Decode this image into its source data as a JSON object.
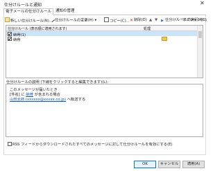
{
  "window": {
    "title": "仕分けルールと通知",
    "close_glyph": "✕"
  },
  "tabs": [
    {
      "label": "電子メールの仕分けルール"
    },
    {
      "label": "通知の管理"
    }
  ],
  "toolbar": {
    "new_rule": "新しい仕分けルール(N)...",
    "change_rule": "仕分けルールの変更(H) ▾",
    "copy": "コピー(C)...",
    "delete": "削除(D)",
    "move_up": "▲",
    "move_down": "▼",
    "run_rules": "仕分けルールの実行(R)...",
    "options": "オプション(O)"
  },
  "rules_list": {
    "header_name": "仕分けルール (表示順に適用されます)",
    "header_actions": "処理",
    "rules": [
      {
        "name": "納骨(1)",
        "checked": true,
        "selected": true,
        "action_icon": ""
      },
      {
        "name": "納骨",
        "checked": true,
        "selected": false,
        "action_icon": "folder-icon"
      }
    ]
  },
  "description": {
    "label": "仕分けルールの説明 (下線をクリックすると編集できます)(L):",
    "line1": "このメッセージが届いたとき",
    "line2_prefix": "[件名] に",
    "line2_link": "納骨",
    "line2_suffix": "が含まれる場合",
    "line3_link": "山田太郎 (xxxxxx@xxxxx.co.jp)",
    "line3_suffix": "へ転送する"
  },
  "rss_option": {
    "label": "RSS フィードからダウンロードされたすべてのメッセージに対して仕分けルールを有効にする(E)",
    "checked": false
  },
  "buttons": {
    "ok": "OK",
    "cancel": "キャンセル",
    "apply": "適用(A)"
  }
}
